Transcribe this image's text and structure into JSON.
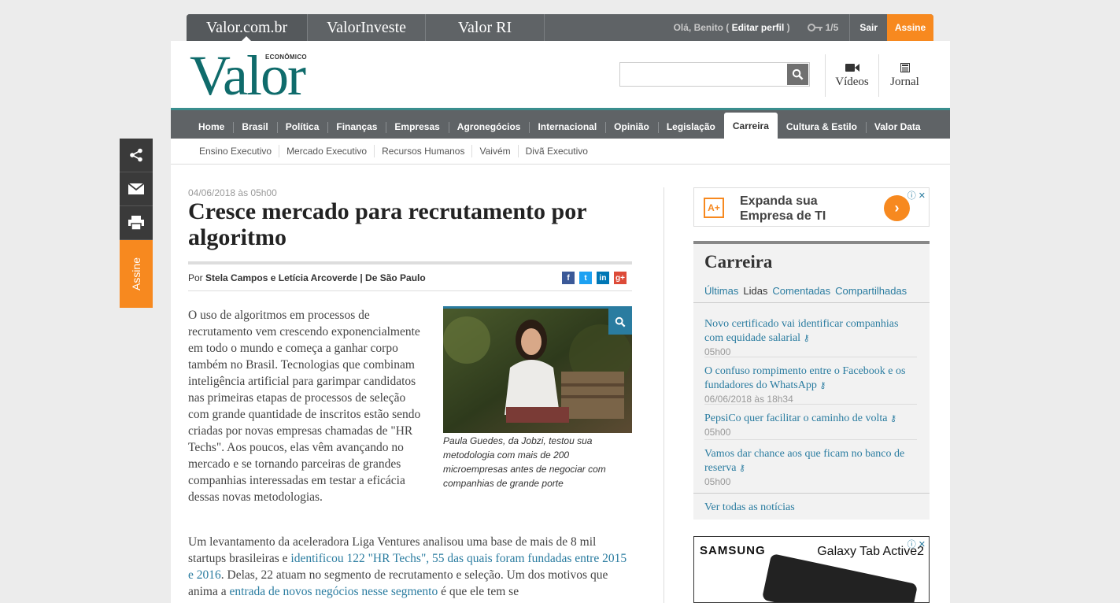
{
  "topbar": {
    "sites": [
      "Valor.com.br",
      "ValorInveste",
      "Valor RI"
    ],
    "greeting_prefix": "Olá, Benito (",
    "edit_profile": "Editar perfil",
    "greeting_suffix": ")",
    "keys_count": "1/5",
    "logout": "Sair",
    "subscribe": "Assine"
  },
  "header": {
    "logo_small": "ECONÔMICO",
    "logo_big": "Valor",
    "search_placeholder": "",
    "videos": "Vídeos",
    "jornal": "Jornal"
  },
  "mainnav": [
    "Home",
    "Brasil",
    "Política",
    "Finanças",
    "Empresas",
    "Agronegócios",
    "Internacional",
    "Opinião",
    "Legislação",
    "Carreira",
    "Cultura & Estilo",
    "Valor Data"
  ],
  "mainnav_active": "Carreira",
  "subnav": [
    "Ensino Executivo",
    "Mercado Executivo",
    "Recursos Humanos",
    "Vaivém",
    "Divã Executivo"
  ],
  "share_sidebar": {
    "subscribe": "Assine"
  },
  "article": {
    "date": "04/06/2018 às 05h00",
    "title": "Cresce mercado para recrutamento por algoritmo",
    "byline_prefix": "Por",
    "authors": "Stela Campos e Letícia Arcoverde | De São Paulo",
    "social": [
      "f",
      "t",
      "in",
      "g+"
    ],
    "p1": "O uso de algoritmos em processos de recrutamento vem crescendo exponencialmente em todo o mundo e começa a ganhar corpo também no Brasil. Tecnologias que combinam inteligência artificial para garimpar candidatos nas primeiras etapas de processos de seleção com grande quantidade de inscritos estão sendo criadas por novas empresas chamadas de \"HR Techs\". Aos poucos, elas vêm avançando no mercado e se tornando parceiras de grandes companhias interessadas em testar a eficácia dessas novas metodologias.",
    "p2_a": "Um levantamento da aceleradora Liga Ventures analisou uma base de mais de 8 mil startups brasileiras e ",
    "p2_link1": "identificou 122 \"HR Techs\", 55 das quais foram fundadas entre 2015 e 2016",
    "p2_b": ". Delas, 22 atuam no segmento de recrutamento e seleção. Um dos motivos que anima a ",
    "p2_link2": "entrada de novos negócios nesse segmento",
    "p2_c": " é que ele tem se",
    "caption": "Paula Guedes, da Jobzi, testou sua metodologia com mais de 200 microempresas antes de negociar com companhias de grande porte"
  },
  "ad1": {
    "text": "Expanda sua Empresa de TI"
  },
  "widget": {
    "title": "Carreira",
    "tabs": [
      "Últimas",
      "Lidas",
      "Comentadas",
      "Compartilhadas"
    ],
    "active_tab": "Lidas",
    "items": [
      {
        "headline": "Novo certificado vai identificar companhias com equidade salarial",
        "time": "05h00"
      },
      {
        "headline": "O confuso rompimento entre o Facebook e os fundadores do WhatsApp",
        "time": "06/06/2018 às 18h34"
      },
      {
        "headline": "PepsiCo quer facilitar o caminho de volta",
        "time": "05h00"
      },
      {
        "headline": "Vamos dar chance aos que ficam no banco de reserva",
        "time": "05h00"
      }
    ],
    "see_all": "Ver todas as notícias"
  },
  "ad2": {
    "brand": "SAMSUNG",
    "product": "Galaxy Tab Active2"
  },
  "colors": {
    "accent": "#f7891f",
    "brand_teal": "#0f6b6b",
    "link": "#2a7ca0",
    "nav": "#5f6366"
  }
}
